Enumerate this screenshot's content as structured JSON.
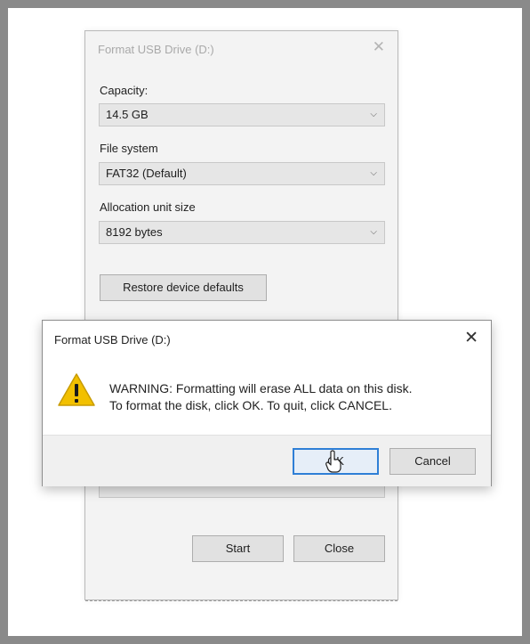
{
  "format_dialog": {
    "title": "Format USB Drive (D:)",
    "close_glyph": "✕",
    "capacity": {
      "label": "Capacity:",
      "value": "14.5 GB"
    },
    "file_system": {
      "label": "File system",
      "value": "FAT32 (Default)"
    },
    "allocation": {
      "label": "Allocation unit size",
      "value": "8192 bytes"
    },
    "restore_label": "Restore device defaults",
    "start_label": "Start",
    "close_label": "Close",
    "chevron_glyph": "⌵"
  },
  "warning_dialog": {
    "title": "Format USB Drive (D:)",
    "close_glyph": "✕",
    "message_line1": "WARNING: Formatting will erase ALL data on this disk.",
    "message_line2": "To format the disk, click OK. To quit, click CANCEL.",
    "ok_label": "OK",
    "cancel_label": "Cancel",
    "icon": "warning-triangle-icon"
  },
  "colors": {
    "frame_border": "#8a8a8a",
    "warning_yellow": "#f2c000",
    "focus_blue": "#2f7fd6"
  }
}
